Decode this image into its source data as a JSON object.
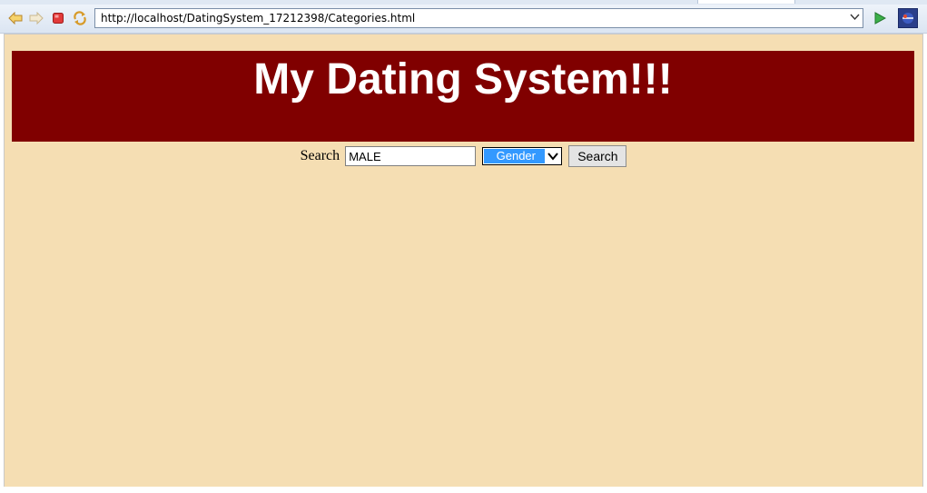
{
  "browser": {
    "url": "http://localhost/DatingSystem_17212398/Categories.html",
    "toolbar_icons": [
      "back-icon",
      "forward-icon",
      "stop-icon",
      "refresh-icon",
      "go-icon",
      "eclipse-icon"
    ]
  },
  "page": {
    "title": "My Dating System!!!",
    "search": {
      "label": "Search",
      "input_value": "MALE",
      "category_selected": "Gender",
      "button_label": "Search"
    }
  },
  "colors": {
    "page_background": "#f5deb3",
    "header_background": "#800000",
    "header_text": "#ffffff",
    "select_highlight": "#3399ff"
  }
}
